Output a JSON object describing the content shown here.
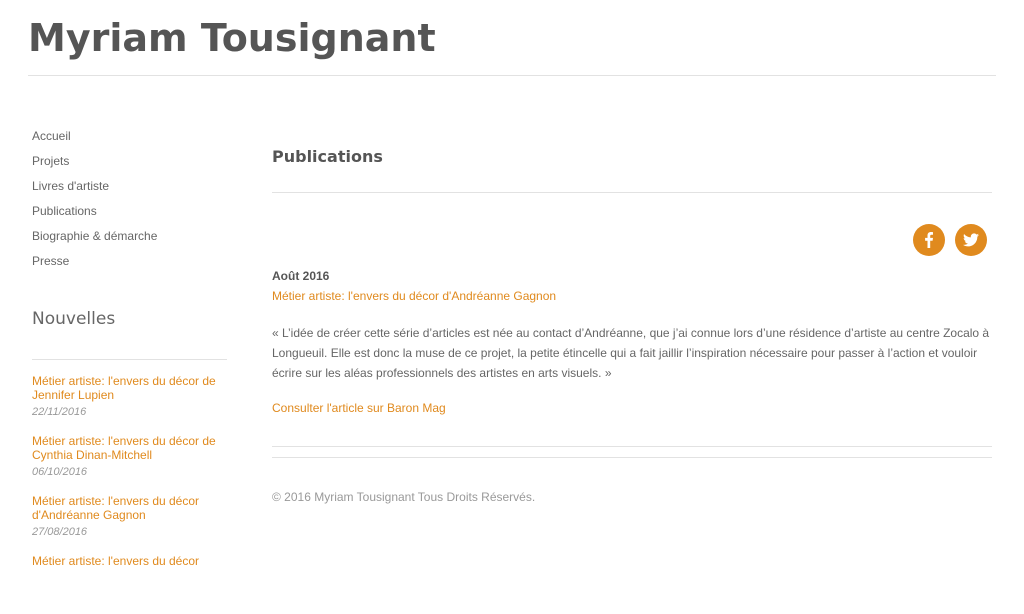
{
  "site": {
    "title": "Myriam Tousignant"
  },
  "nav": {
    "items": [
      {
        "label": "Accueil"
      },
      {
        "label": "Projets"
      },
      {
        "label": "Livres d'artiste"
      },
      {
        "label": "Publications"
      },
      {
        "label": "Biographie & démarche"
      },
      {
        "label": "Presse"
      }
    ]
  },
  "news": {
    "heading": "Nouvelles",
    "items": [
      {
        "title": "Métier artiste: l'envers du décor de Jennifer Lupien",
        "date": "22/11/2016"
      },
      {
        "title": "Métier artiste: l'envers du décor de Cynthia Dinan-Mitchell",
        "date": "06/10/2016"
      },
      {
        "title": "Métier artiste: l'envers du décor d'Andréanne Gagnon",
        "date": "27/08/2016"
      },
      {
        "title": "Métier artiste: l'envers du décor",
        "date": ""
      }
    ]
  },
  "main": {
    "heading": "Publications",
    "social": [
      {
        "icon": "facebook-icon"
      },
      {
        "icon": "twitter-icon"
      }
    ],
    "article": {
      "date": "Août 2016",
      "link": "Métier artiste: l'envers du décor d'Andréanne Gagnon",
      "quote": "« L’idée de créer cette série d’articles est née au contact d’Andréanne, que j’ai connue lors d’une résidence d’artiste au centre Zocalo à Longueuil. Elle est donc la muse de ce projet, la petite étincelle qui a fait jaillir l’inspiration nécessaire pour passer à l’action et vouloir écrire sur les aléas professionnels des artistes en arts visuels. »",
      "consult": "Consulter l'article sur Baron Mag"
    }
  },
  "footer": {
    "copyright": "© 2016 Myriam Tousignant Tous Droits Réservés."
  },
  "colors": {
    "accent": "#e08a1e",
    "text": "#666666",
    "heading": "#555555",
    "rule": "#e2e2e2"
  }
}
